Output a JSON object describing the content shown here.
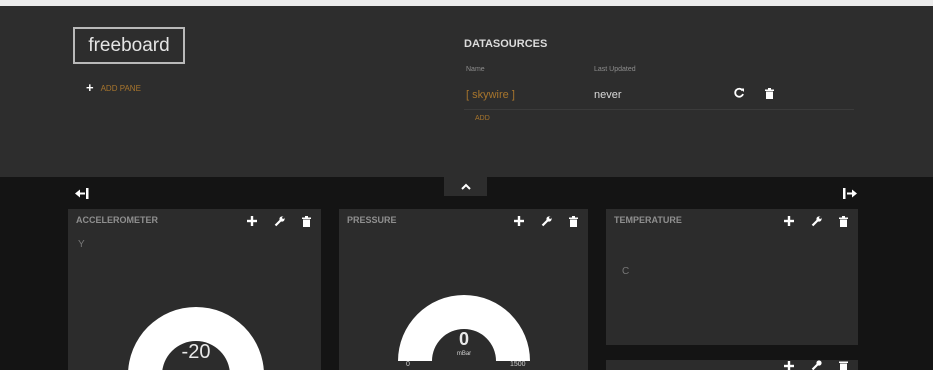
{
  "header": {
    "logo": "freeboard",
    "add_pane": "ADD PANE"
  },
  "datasources": {
    "title": "DATASOURCES",
    "col_name": "Name",
    "col_updated": "Last Updated",
    "rows": [
      {
        "name": "[ skywire ]",
        "last_updated": "never"
      }
    ],
    "add_label": "ADD"
  },
  "panes": {
    "accelerometer": {
      "title": "ACCELEROMETER",
      "label": "Y",
      "value": "-20"
    },
    "pressure": {
      "title": "PRESSURE",
      "value": "0",
      "units": "mBar",
      "min": "0",
      "max": "1500"
    },
    "temperature": {
      "title": "TEMPERATURE",
      "value": "C"
    }
  },
  "icons": {
    "add": "plus-icon",
    "configure": "wrench-icon",
    "delete": "trash-icon",
    "refresh": "refresh-icon",
    "collapse": "chevron-up-icon",
    "shift_left": "arrow-left-bar-icon",
    "shift_right": "arrow-right-bar-icon"
  },
  "colors": {
    "accent": "#a7752d",
    "pane_bg": "#2c2c2c",
    "admin_bg": "#2d2d2d",
    "board_bg": "#141414",
    "gauge_fill": "#ffffff"
  }
}
